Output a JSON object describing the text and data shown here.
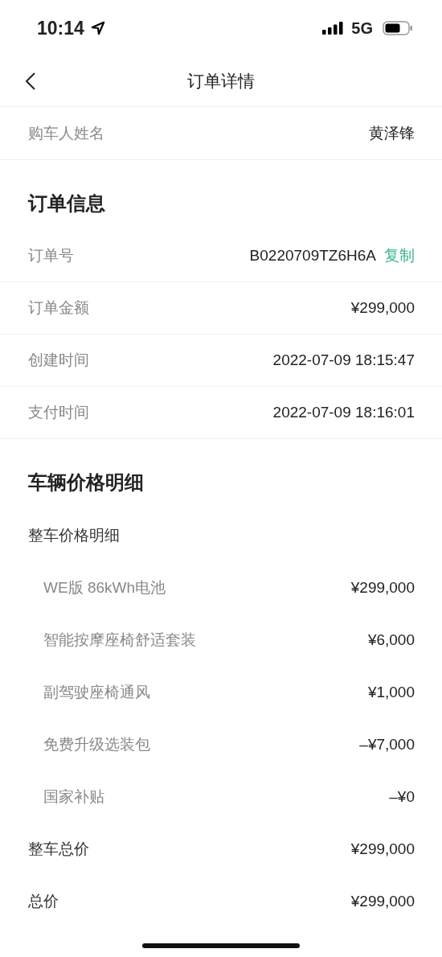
{
  "status_bar": {
    "time": "10:14",
    "network": "5G"
  },
  "nav": {
    "title": "订单详情"
  },
  "buyer": {
    "label": "购车人姓名",
    "value": "黄泽锋"
  },
  "sections": [
    {
      "title": "订单信息",
      "rows": [
        {
          "kind": "info",
          "label": "订单号",
          "value": "B0220709TZ6H6A",
          "action": "复制"
        },
        {
          "kind": "info",
          "label": "订单金额",
          "value": "¥299,000"
        },
        {
          "kind": "info",
          "label": "创建时间",
          "value": "2022-07-09 18:15:47"
        },
        {
          "kind": "info",
          "label": "支付时间",
          "value": "2022-07-09 18:16:01"
        }
      ]
    },
    {
      "title": "车辆价格明细",
      "rows": [
        {
          "kind": "group",
          "label": "整车价格明细"
        },
        {
          "kind": "item",
          "label": "WE版 86kWh电池",
          "value": "¥299,000"
        },
        {
          "kind": "item",
          "label": "智能按摩座椅舒适套装",
          "value": "¥6,000"
        },
        {
          "kind": "item",
          "label": "副驾驶座椅通风",
          "value": "¥1,000"
        },
        {
          "kind": "item",
          "label": "免费升级选装包",
          "value": "–¥7,000"
        },
        {
          "kind": "item",
          "label": "国家补贴",
          "value": "–¥0"
        },
        {
          "kind": "total",
          "label": "整车总价",
          "value": "¥299,000"
        },
        {
          "kind": "total",
          "label": "总价",
          "value": "¥299,000"
        }
      ]
    }
  ]
}
